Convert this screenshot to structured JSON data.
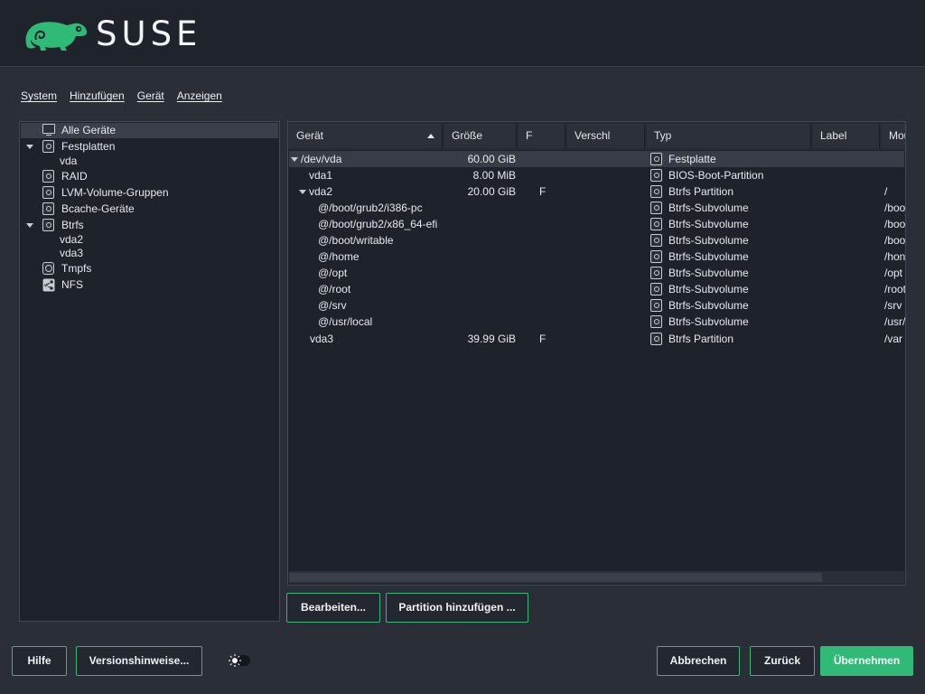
{
  "brand": {
    "name": "SUSE",
    "logo_icon": "chameleon-logo-icon",
    "logo_color": "#30ba78"
  },
  "menubar": {
    "items": [
      {
        "label": "System"
      },
      {
        "label": "Hinzufügen"
      },
      {
        "label": "Gerät"
      },
      {
        "label": "Anzeigen"
      }
    ]
  },
  "tree": {
    "items": [
      {
        "label": "Alle Geräte",
        "icon": "monitor-icon",
        "selected": true
      },
      {
        "label": "Festplatten",
        "icon": "disk-icon",
        "expanded": true
      },
      {
        "label": "vda"
      },
      {
        "label": "RAID",
        "icon": "disk-icon"
      },
      {
        "label": "LVM-Volume-Gruppen",
        "icon": "disk-icon"
      },
      {
        "label": "Bcache-Geräte",
        "icon": "disk-icon"
      },
      {
        "label": "Btrfs",
        "icon": "disk-icon",
        "expanded": true
      },
      {
        "label": "vda2"
      },
      {
        "label": "vda3"
      },
      {
        "label": "Tmpfs",
        "icon": "clock-icon"
      },
      {
        "label": "NFS",
        "icon": "share-icon"
      }
    ]
  },
  "table": {
    "columns": [
      "Gerät",
      "Größe",
      "F",
      "Verschl",
      "Typ",
      "Label",
      "Mou"
    ],
    "sort_column": "Gerät",
    "rows": [
      {
        "device": "/dev/vda",
        "size": "60.00 GiB",
        "f": "",
        "type": "Festplatte",
        "mount": ""
      },
      {
        "device": "vda1",
        "size": "8.00 MiB",
        "f": "",
        "type": "BIOS-Boot-Partition",
        "mount": ""
      },
      {
        "device": "vda2",
        "size": "20.00 GiB",
        "f": "F",
        "type": "Btrfs Partition",
        "mount": "/"
      },
      {
        "device": "@/boot/grub2/i386-pc",
        "size": "",
        "f": "",
        "type": "Btrfs-Subvolume",
        "mount": "/boo"
      },
      {
        "device": "@/boot/grub2/x86_64-efi",
        "size": "",
        "f": "",
        "type": "Btrfs-Subvolume",
        "mount": "/boo"
      },
      {
        "device": "@/boot/writable",
        "size": "",
        "f": "",
        "type": "Btrfs-Subvolume",
        "mount": "/boo"
      },
      {
        "device": "@/home",
        "size": "",
        "f": "",
        "type": "Btrfs-Subvolume",
        "mount": "/hon"
      },
      {
        "device": "@/opt",
        "size": "",
        "f": "",
        "type": "Btrfs-Subvolume",
        "mount": "/opt"
      },
      {
        "device": "@/root",
        "size": "",
        "f": "",
        "type": "Btrfs-Subvolume",
        "mount": "/root"
      },
      {
        "device": "@/srv",
        "size": "",
        "f": "",
        "type": "Btrfs-Subvolume",
        "mount": "/srv"
      },
      {
        "device": "@/usr/local",
        "size": "",
        "f": "",
        "type": "Btrfs-Subvolume",
        "mount": "/usr/"
      },
      {
        "device": "vda3",
        "size": "39.99 GiB",
        "f": "F",
        "type": "Btrfs Partition",
        "mount": "/var"
      }
    ]
  },
  "actions": {
    "edit": "Bearbeiten...",
    "add_partition": "Partition hinzufügen ..."
  },
  "footer": {
    "help": "Hilfe",
    "release_notes": "Versionshinweise...",
    "cancel": "Abbrechen",
    "back": "Zurück",
    "accept": "Übernehmen",
    "theme_icon": "sun-toggle-icon"
  },
  "colors": {
    "accent": "#30ba78",
    "background": "#2a2e37",
    "panel": "#1e222a"
  }
}
